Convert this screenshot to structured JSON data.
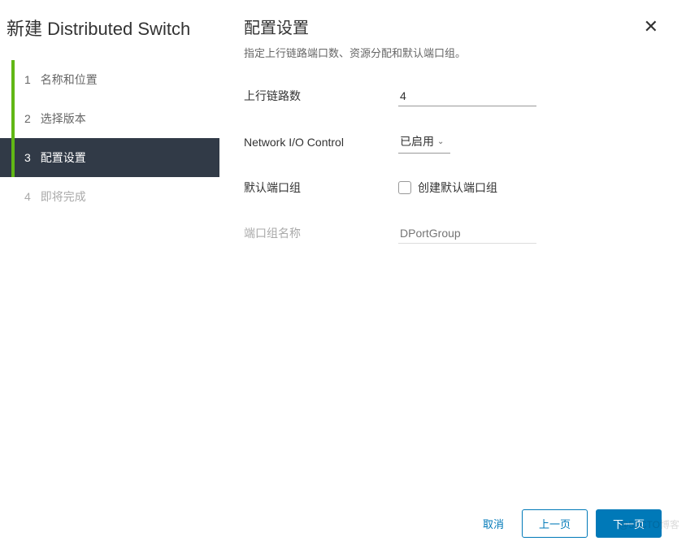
{
  "sidebar": {
    "title": "新建 Distributed Switch",
    "steps": [
      {
        "num": "1",
        "label": "名称和位置",
        "state": "completed"
      },
      {
        "num": "2",
        "label": "选择版本",
        "state": "completed"
      },
      {
        "num": "3",
        "label": "配置设置",
        "state": "active"
      },
      {
        "num": "4",
        "label": "即将完成",
        "state": "future"
      }
    ]
  },
  "main": {
    "title": "配置设置",
    "subtitle": "指定上行链路端口数、资源分配和默认端口组。",
    "form": {
      "uplinks_label": "上行链路数",
      "uplinks_value": "4",
      "nioc_label": "Network I/O Control",
      "nioc_value": "已启用",
      "default_pg_label": "默认端口组",
      "default_pg_checkbox_label": "创建默认端口组",
      "pg_name_label": "端口组名称",
      "pg_name_placeholder": "DPortGroup"
    }
  },
  "footer": {
    "cancel": "取消",
    "back": "上一页",
    "next": "下一页"
  },
  "watermark": "@51CTO博客"
}
